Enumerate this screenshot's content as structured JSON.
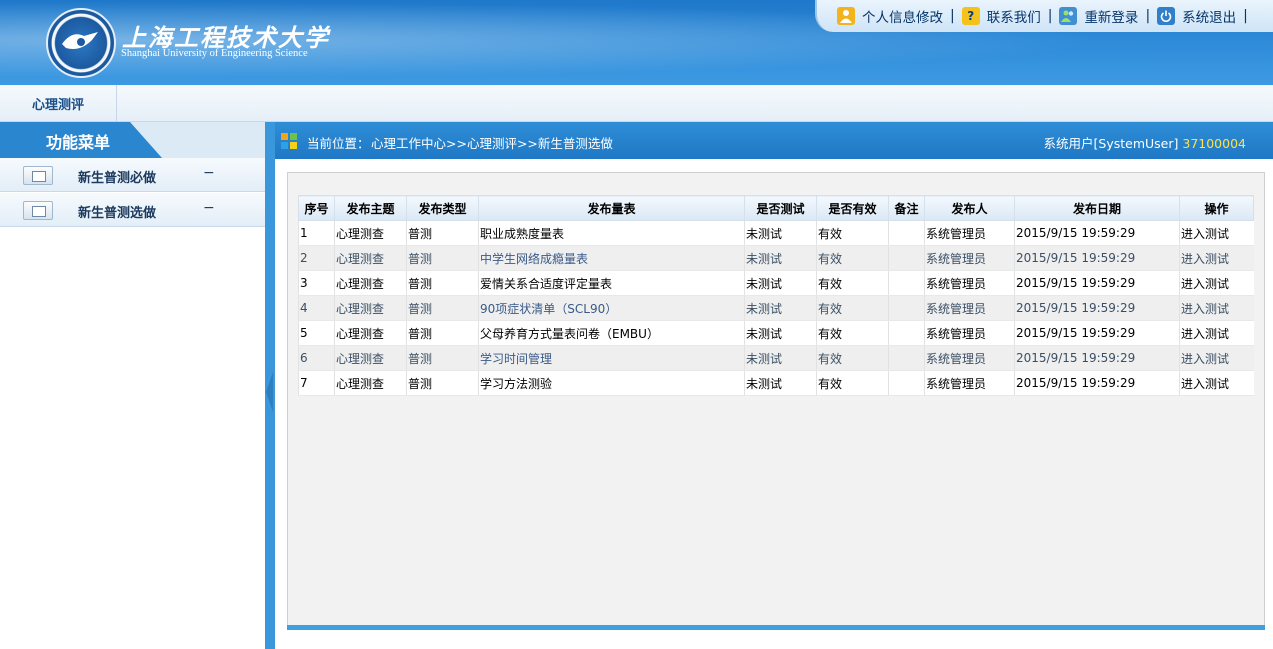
{
  "header": {
    "logo_cn": "上海工程技术大学",
    "logo_en": "Shanghai University of Engineering Science",
    "nav": [
      {
        "label": "个人信息修改",
        "icon": "user-icon"
      },
      {
        "label": "联系我们",
        "icon": "help-icon"
      },
      {
        "label": "重新登录",
        "icon": "users-icon"
      },
      {
        "label": "系统退出",
        "icon": "power-icon"
      }
    ],
    "separator": "|"
  },
  "subbar": {
    "module_tab": "心理测评"
  },
  "sidebar": {
    "title": "功能菜单",
    "items": [
      {
        "label": "新生普测必做",
        "toggle": "−"
      },
      {
        "label": "新生普测选做",
        "toggle": "−"
      }
    ]
  },
  "mainbar": {
    "location_label": "当前位置：",
    "location_path": "心理工作中心>>心理测评>>新生普测选做",
    "user_label": "系统用户[SystemUser]",
    "user_id": "37100004"
  },
  "table": {
    "columns": [
      "序号",
      "发布主题",
      "发布类型",
      "发布量表",
      "是否测试",
      "是否有效",
      "备注",
      "发布人",
      "发布日期",
      "操作"
    ],
    "rows": [
      [
        "1",
        "心理测查",
        "普测",
        "职业成熟度量表",
        "未测试",
        "有效",
        "",
        "系统管理员",
        "2015/9/15 19:59:29",
        "进入测试"
      ],
      [
        "2",
        "心理测查",
        "普测",
        "中学生网络成瘾量表",
        "未测试",
        "有效",
        "",
        "系统管理员",
        "2015/9/15 19:59:29",
        "进入测试"
      ],
      [
        "3",
        "心理测查",
        "普测",
        "爱情关系合适度评定量表",
        "未测试",
        "有效",
        "",
        "系统管理员",
        "2015/9/15 19:59:29",
        "进入测试"
      ],
      [
        "4",
        "心理测查",
        "普测",
        "90项症状清单（SCL90）",
        "未测试",
        "有效",
        "",
        "系统管理员",
        "2015/9/15 19:59:29",
        "进入测试"
      ],
      [
        "5",
        "心理测查",
        "普测",
        "父母养育方式量表问卷（EMBU）",
        "未测试",
        "有效",
        "",
        "系统管理员",
        "2015/9/15 19:59:29",
        "进入测试"
      ],
      [
        "6",
        "心理测查",
        "普测",
        "学习时间管理",
        "未测试",
        "有效",
        "",
        "系统管理员",
        "2015/9/15 19:59:29",
        "进入测试"
      ],
      [
        "7",
        "心理测查",
        "普测",
        "学习方法测验",
        "未测试",
        "有效",
        "",
        "系统管理员",
        "2015/9/15 19:59:29",
        "进入测试"
      ]
    ]
  },
  "colors": {
    "header_blue": "#2d8ad8",
    "bar_blue": "#2f8dd6",
    "user_id_yellow": "#ffe14a",
    "row_alt": "#efefef"
  }
}
